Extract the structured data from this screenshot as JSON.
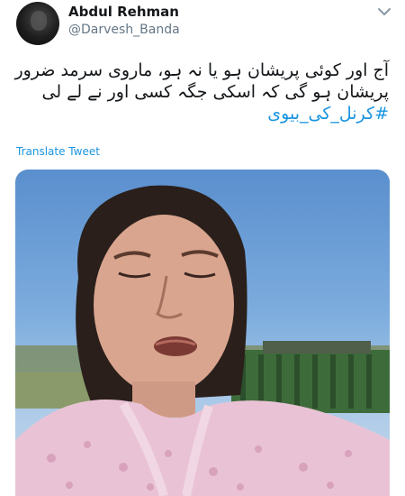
{
  "tweet": {
    "display_name": "Abdul Rehman",
    "handle": "@Darvesh_Banda",
    "text_lines": [
      "آج اور کوئی پریشان ہو یا نہ ہو، ماروی سرمد ضرور",
      "پریشان ہو گی کہ اسکی جگہ کسی اور نے لے لی"
    ],
    "hashtag": "#کرنل_کی_بیوی",
    "translate_label": "Translate Tweet"
  },
  "icons": {
    "menu": "chevron-down-icon",
    "avatar": "avatar"
  },
  "colors": {
    "link": "#1b95e0",
    "secondary_text": "#657786",
    "primary_text": "#14171a"
  }
}
